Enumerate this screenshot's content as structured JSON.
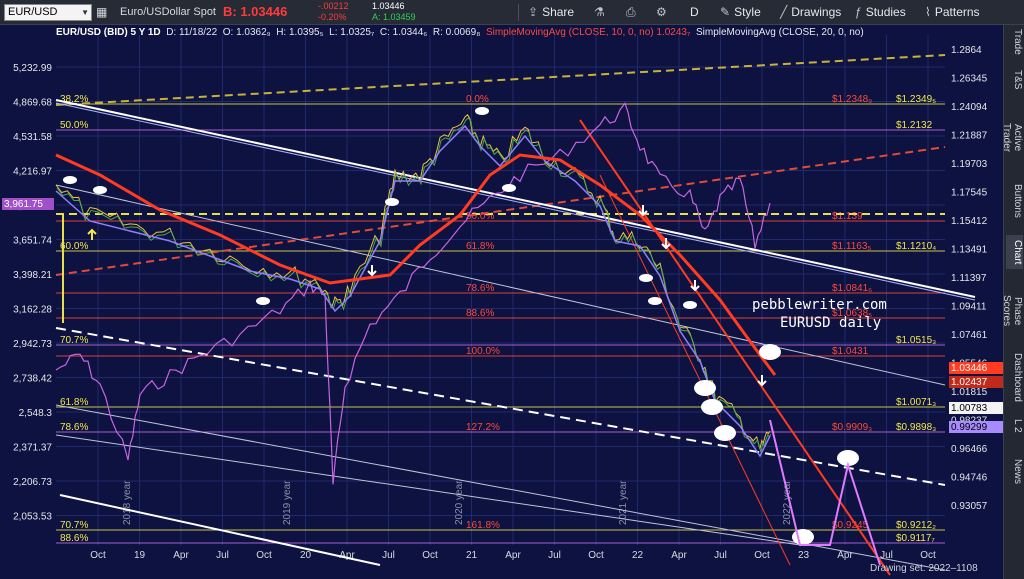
{
  "toolbar": {
    "symbol": "EUR/USD",
    "description": "Euro/USDollar Spot",
    "bid": "B: 1.03446",
    "change": "-.00212",
    "change_pct": "-0.20%",
    "ask": "A: 1.03459",
    "ask_prefix": "1.03446",
    "share_label": "Share",
    "timeframe_label": "D",
    "style_label": "Style",
    "drawings_label": "Drawings",
    "studies_label": "Studies",
    "patterns_label": "Patterns"
  },
  "study_bar": {
    "title": "EUR/USD (BID) 5 Y 1D",
    "date": "D: 11/18/22",
    "open": "O: 1.0362₉",
    "high": "H: 1.0395₅",
    "low": "L: 1.0325₇",
    "close": "C: 1.0344₆",
    "range": "R: 0.0069₈",
    "sma10": "SimpleMovingAvg (CLOSE, 10, 0, no)",
    "sma10_value": "1.0243₇",
    "sma20": "SimpleMovingAvg (CLOSE, 20, 0, no)"
  },
  "left_axis": [
    "5,232.99",
    "4,869.68",
    "4,531.58",
    "4,216.97",
    "3,961.75",
    "3,651.74",
    "3,398.21",
    "3,162.28",
    "2,942.73",
    "2,738.42",
    "2,548.3",
    "2,371.37",
    "2,206.73",
    "2,053.53"
  ],
  "right_axis": [
    "1.2864",
    "1.26345",
    "1.24094",
    "1.21887",
    "1.19703",
    "1.17545",
    "1.15412",
    "1.13491",
    "1.11397",
    "1.09411",
    "1.07461",
    "1.05546",
    "1.01815",
    "0.98237",
    "0.96466",
    "0.94746",
    "0.93057"
  ],
  "x_axis": [
    "Oct",
    "19",
    "Apr",
    "Jul",
    "Oct",
    "20",
    "Apr",
    "Jul",
    "Oct",
    "21",
    "Apr",
    "Jul",
    "Oct",
    "22",
    "Apr",
    "Jul",
    "Oct",
    "23",
    "Apr",
    "Jul",
    "Oct"
  ],
  "year_markers": [
    "2018 year",
    "2019 year",
    "2020 year",
    "2021 year",
    "2022 year"
  ],
  "fib_levels": [
    {
      "left": "38.2%",
      "center": "0.0%",
      "price": "$1.2348₉",
      "level": "$1.2349₅",
      "color": "#e8e04a"
    },
    {
      "left": "50.0%",
      "center": "",
      "price": "",
      "level": "$1.2132",
      "color": "#c46be8"
    },
    {
      "left": "",
      "center": "50.0%",
      "price": "$1.139",
      "level": "",
      "color": "#ff4a3d"
    },
    {
      "left": "60.0%",
      "center": "61.8%",
      "price": "$1.1163₅",
      "level": "$1.1210₄",
      "color": "#e8e04a"
    },
    {
      "left": "",
      "center": "78.6%",
      "price": "$1.0841₆",
      "level": "",
      "color": "#ff4a3d"
    },
    {
      "left": "",
      "center": "88.6%",
      "price": "$1.0638₅",
      "level": "",
      "color": "#ff4a3d"
    },
    {
      "left": "70.7%",
      "center": "",
      "price": "",
      "level": "$1.0515₃",
      "color": "#c46be8"
    },
    {
      "left": "",
      "center": "100.0%",
      "price": "$1.0431",
      "level": "",
      "color": "#ff4a3d"
    },
    {
      "left": "61.8%",
      "center": "",
      "price": "",
      "level": "$1.0071₃",
      "color": "#e8e04a"
    },
    {
      "left": "78.6%",
      "center": "127.2%",
      "price": "$0.9909₃",
      "level": "$0.9898₃",
      "color": "#c46be8"
    },
    {
      "left": "70.7%",
      "center": "161.8%",
      "price": "$0.9245",
      "level": "$0.9212₂",
      "color": "#e8e04a"
    },
    {
      "left": "88.6%",
      "center": "",
      "price": "",
      "level": "$0.9117₇",
      "color": "#c46be8"
    }
  ],
  "price_tags": {
    "left_current": "3,961.75",
    "last_price": "1.03446",
    "sma10_tag": "1.02437",
    "level_1": "1.00783",
    "level_2": "0.99299"
  },
  "watermark": {
    "line1": "pebblewriter.com",
    "line2": "EURUSD daily"
  },
  "right_rail": [
    "Trade",
    "T&S",
    "Active Trader",
    "Buttons",
    "Chart",
    "Phase Scores",
    "Dashboard",
    "L 2",
    "News"
  ],
  "drawing_set": "Drawing set: 2022–1108"
}
